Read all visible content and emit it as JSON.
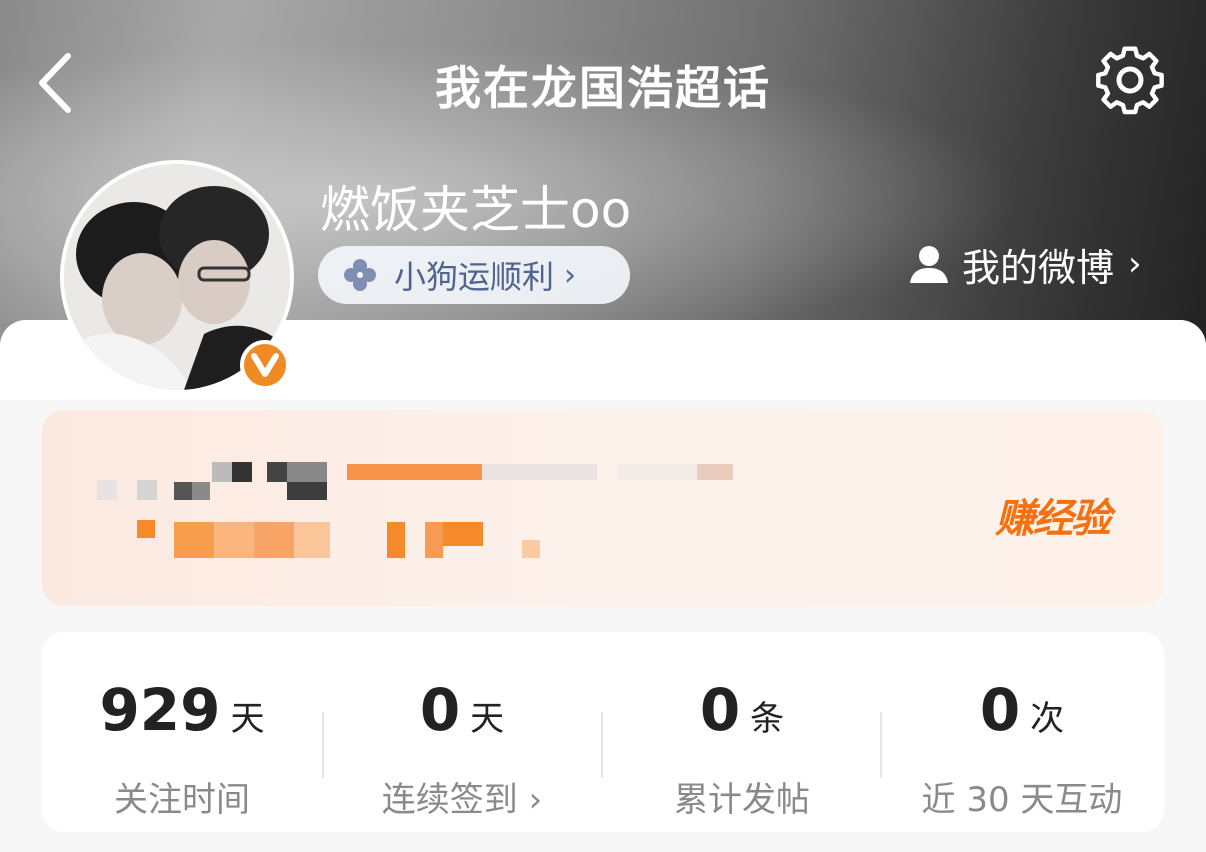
{
  "header": {
    "title": "我在龙国浩超话",
    "back_icon": "back-chevron-icon",
    "settings_icon": "gear-icon"
  },
  "profile": {
    "username": "燃饭夹芝士oo",
    "badge_label": "小狗运顺利",
    "badge_icon": "clover-icon",
    "badge_chevron": "›",
    "my_weibo_label": "我的微博",
    "my_weibo_chevron": "›",
    "verified_icon": "v-verified-icon"
  },
  "promo": {
    "earn_label": "赚经验"
  },
  "stats": [
    {
      "value": "929",
      "unit": "天",
      "label": "关注时间"
    },
    {
      "value": "0",
      "unit": "天",
      "label": "连续签到 ›"
    },
    {
      "value": "0",
      "unit": "条",
      "label": "累计发帖"
    },
    {
      "value": "0",
      "unit": "次",
      "label": "近 30 天互动"
    }
  ],
  "colors": {
    "accent_orange": "#f5700f",
    "badge_text": "#51648f",
    "verified_badge": "#f08a24"
  }
}
